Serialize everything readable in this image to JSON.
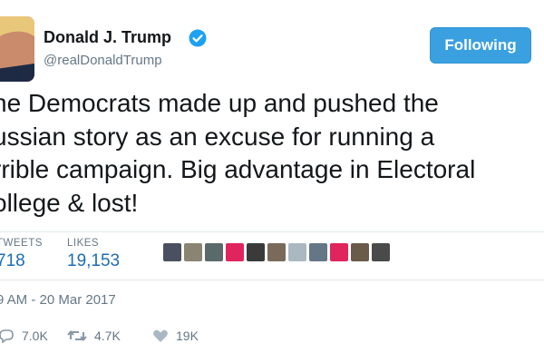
{
  "user": {
    "display_name": "Donald J. Trump",
    "handle": "@realDonaldTrump",
    "verified_icon": "verified-badge-icon"
  },
  "follow_button": {
    "label": "Following",
    "color": "#3ba0e0"
  },
  "tweet": {
    "lines": [
      "he Democrats made up and pushed the",
      "ussian story as an excuse for running a",
      "rrible campaign. Big advantage in Electoral",
      "ollege & lost!"
    ]
  },
  "stats": {
    "retweets_label": "TWEETS",
    "retweets_value": "718",
    "likes_label": "LIKES",
    "likes_value": "19,153"
  },
  "liker_avatars": [
    {
      "name": "liker-avatar-1",
      "color": "#4a5060"
    },
    {
      "name": "liker-avatar-2",
      "color": "#8a8572"
    },
    {
      "name": "liker-avatar-3",
      "color": "#5a6a6a"
    },
    {
      "name": "liker-avatar-4",
      "color": "#e0245e"
    },
    {
      "name": "liker-avatar-5",
      "color": "#3a3a3a"
    },
    {
      "name": "liker-avatar-6",
      "color": "#7a6a5a"
    },
    {
      "name": "liker-avatar-7",
      "color": "#aab8c2"
    },
    {
      "name": "liker-avatar-8",
      "color": "#657786"
    },
    {
      "name": "liker-avatar-9",
      "color": "#e0245e"
    },
    {
      "name": "liker-avatar-10",
      "color": "#6a5a4a"
    },
    {
      "name": "liker-avatar-11",
      "color": "#4a4a4a"
    }
  ],
  "timestamp": "9 AM - 20 Mar 2017",
  "actions": {
    "reply_count": "7.0K",
    "retweet_count": "4.7K",
    "like_count": "19K",
    "reply_icon": "reply-icon",
    "retweet_icon": "retweet-icon",
    "like_icon": "heart-icon"
  }
}
